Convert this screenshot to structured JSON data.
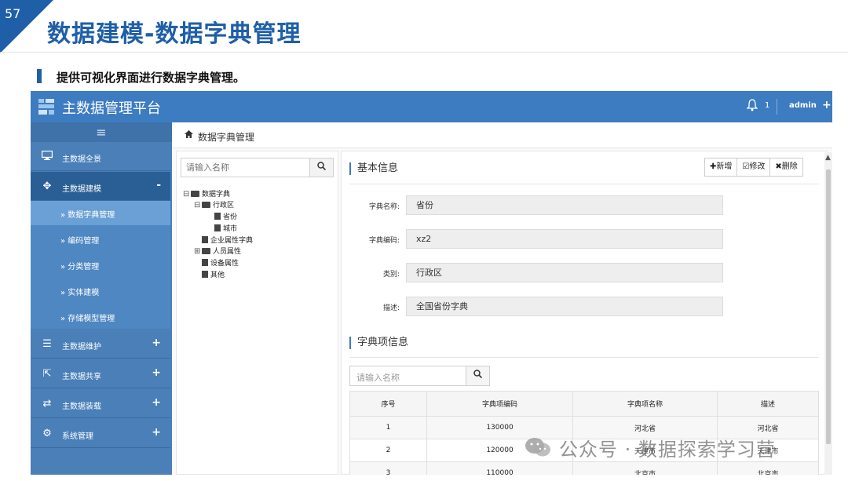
{
  "slide": {
    "page_number": "57",
    "title": "数据建模-数据字典管理",
    "bullet": "提供可视化界面进行数据字典管理。"
  },
  "app": {
    "title": "主数据管理平台",
    "notification_count": "1",
    "user": "admin",
    "top_plus": "+"
  },
  "sidebar": {
    "toggle": "≡",
    "items": [
      {
        "label": "主数据全景",
        "icon": "monitor-icon",
        "toggle": ""
      },
      {
        "label": "主数据建模",
        "icon": "gear-icon",
        "toggle": "-"
      },
      {
        "label": "主数据维护",
        "icon": "list-icon",
        "toggle": "+"
      },
      {
        "label": "主数据共享",
        "icon": "share-icon",
        "toggle": "+"
      },
      {
        "label": "主数据装载",
        "icon": "sync-icon",
        "toggle": "+"
      },
      {
        "label": "系统管理",
        "icon": "cogs-icon",
        "toggle": "+"
      }
    ],
    "subitems": [
      {
        "label": "» 数据字典管理"
      },
      {
        "label": "» 编码管理"
      },
      {
        "label": "» 分类管理"
      },
      {
        "label": "» 实体建模"
      },
      {
        "label": "» 存储模型管理"
      }
    ]
  },
  "breadcrumb": {
    "home_icon": "home-icon",
    "label": "数据字典管理"
  },
  "tree": {
    "search_placeholder": "请输入名称",
    "nodes": [
      {
        "label": "数据字典",
        "toggle": "⊟",
        "kind": "folder"
      },
      {
        "label": "行政区",
        "toggle": "⊟",
        "kind": "folder"
      },
      {
        "label": "省份",
        "toggle": "",
        "kind": "file"
      },
      {
        "label": "城市",
        "toggle": "",
        "kind": "file"
      },
      {
        "label": "企业属性字典",
        "toggle": "",
        "kind": "file"
      },
      {
        "label": "人员属性",
        "toggle": "⊞",
        "kind": "folder"
      },
      {
        "label": "设备属性",
        "toggle": "",
        "kind": "file"
      },
      {
        "label": "其他",
        "toggle": "",
        "kind": "file"
      }
    ]
  },
  "basic_info": {
    "title": "基本信息",
    "buttons": {
      "add": "✚新增",
      "edit": "☑修改",
      "delete": "✖删除"
    },
    "fields": [
      {
        "label": "字典名称:",
        "value": "省份"
      },
      {
        "label": "字典编码:",
        "value": "xz2"
      },
      {
        "label": "类别:",
        "value": "行政区"
      },
      {
        "label": "描述:",
        "value": "全国省份字典"
      }
    ]
  },
  "items_info": {
    "title": "字典项信息",
    "search_placeholder": "请输入名称",
    "columns": [
      "序号",
      "字典项编码",
      "字典项名称",
      "描述"
    ],
    "rows": [
      [
        "1",
        "130000",
        "河北省",
        "河北省"
      ],
      [
        "2",
        "120000",
        "天津市",
        "天津市"
      ],
      [
        "3",
        "110000",
        "北京市",
        "北京市"
      ]
    ]
  },
  "watermark": "公众号 · 数据探索学习营"
}
